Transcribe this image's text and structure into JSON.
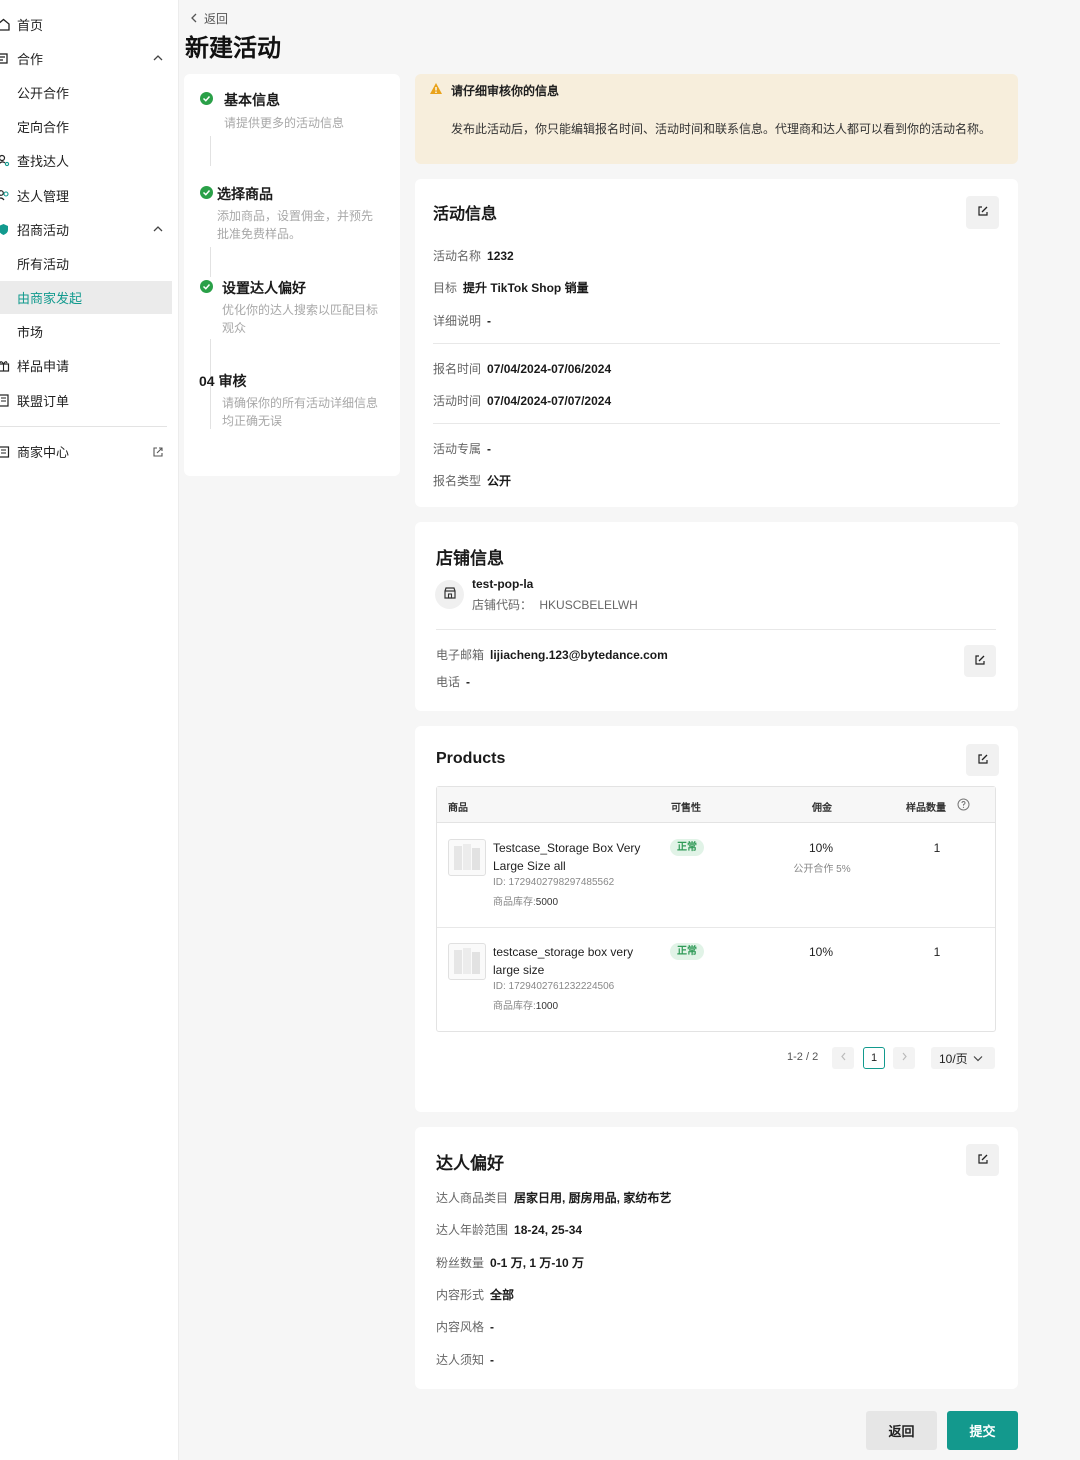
{
  "sidebar": {
    "home": "首页",
    "collab": "合作",
    "public_collab": "公开合作",
    "targeted_collab": "定向合作",
    "find_creators": "查找达人",
    "creator_mgmt": "达人管理",
    "campaigns": "招商活动",
    "all_campaigns": "所有活动",
    "by_seller": "由商家发起",
    "market": "市场",
    "sample_requests": "样品申请",
    "affiliate_orders": "联盟订单",
    "seller_center": "商家中心"
  },
  "header": {
    "back": "返回",
    "title": "新建活动"
  },
  "steps": [
    {
      "title": "基本信息",
      "desc": "请提供更多的活动信息"
    },
    {
      "title": "选择商品",
      "desc": "添加商品，设置佣金，并预先批准免费样品。"
    },
    {
      "title": "设置达人偏好",
      "desc": "优化你的达人搜索以匹配目标观众"
    },
    {
      "title": "04 审核",
      "desc": "请确保你的所有活动详细信息均正确无误"
    }
  ],
  "warning": {
    "title": "请仔细审核你的信息",
    "body": "发布此活动后，你只能编辑报名时间、活动时间和联系信息。代理商和达人都可以看到你的活动名称。"
  },
  "activity": {
    "title": "活动信息",
    "name_k": "活动名称",
    "name_v": "1232",
    "goal_k": "目标",
    "goal_v": "提升 TikTok Shop 销量",
    "desc_k": "详细说明",
    "desc_v": "-",
    "reg_k": "报名时间",
    "reg_v": "07/04/2024-07/06/2024",
    "time_k": "活动时间",
    "time_v": "07/04/2024-07/07/2024",
    "excl_k": "活动专属",
    "excl_v": "-",
    "type_k": "报名类型",
    "type_v": "公开"
  },
  "shop": {
    "title": "店铺信息",
    "name": "test-pop-la",
    "code_k": "店铺代码：",
    "code_v": "HKUSCBELELWH",
    "email_k": "电子邮箱",
    "email_v": "lijiacheng.123@bytedance.com",
    "phone_k": "电话",
    "phone_v": "-"
  },
  "products": {
    "title": "Products",
    "headers": {
      "product": "商品",
      "availability": "可售性",
      "commission": "佣金",
      "samples": "样品数量"
    },
    "rows": [
      {
        "name": "Testcase_Storage Box Very Large Size all",
        "id": "ID: 1729402798297485562",
        "stock_k": "商品库存:",
        "stock_v": "5000",
        "status": "正常",
        "commission": "10%",
        "commission_sub": "公开合作 5%",
        "qty": "1"
      },
      {
        "name": "testcase_storage box very large size",
        "id": "ID: 1729402761232224506",
        "stock_k": "商品库存:",
        "stock_v": "1000",
        "status": "正常",
        "commission": "10%",
        "commission_sub": "",
        "qty": "1"
      }
    ],
    "pager": {
      "count": "1-2 / 2",
      "current": "1",
      "size": "10/页"
    }
  },
  "prefs": {
    "title": "达人偏好",
    "cat_k": "达人商品类目",
    "cat_v": "居家日用, 厨房用品, 家纺布艺",
    "age_k": "达人年龄范围",
    "age_v": "18-24, 25-34",
    "fans_k": "粉丝数量",
    "fans_v": "0-1 万, 1 万-10 万",
    "format_k": "内容形式",
    "format_v": "全部",
    "style_k": "内容风格",
    "style_v": "-",
    "notes_k": "达人须知",
    "notes_v": "-"
  },
  "footer": {
    "back": "返回",
    "submit": "提交"
  },
  "colors": {
    "accent": "#13998d",
    "success": "#2aa048",
    "warning_bg": "#f7eedc"
  }
}
